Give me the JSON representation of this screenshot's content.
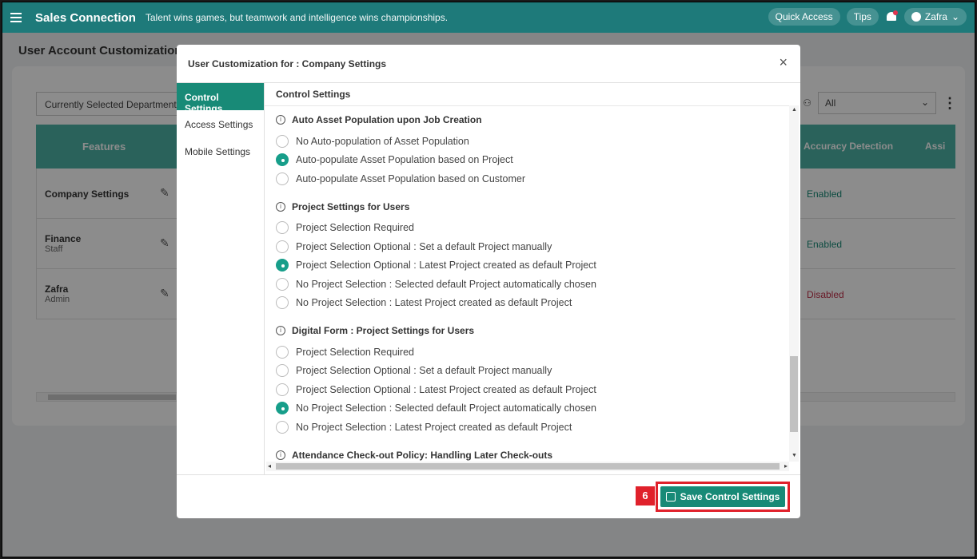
{
  "topbar": {
    "brand": "Sales Connection",
    "tagline": "Talent wins games, but teamwork and intelligence wins championships.",
    "quick_access": "Quick Access",
    "tips": "Tips",
    "user": "Zafra"
  },
  "page": {
    "title": "User Account Customization",
    "dept_select": "Currently Selected Department",
    "right_select": "All",
    "table": {
      "col_features": "Features",
      "col_accuracy": "Accuracy Detection",
      "col_assign": "Assi",
      "rows": [
        {
          "name": "Company Settings",
          "sub": "",
          "status": "Enabled"
        },
        {
          "name": "Finance",
          "sub": "Staff",
          "status": "Enabled"
        },
        {
          "name": "Zafra",
          "sub": "Admin",
          "status": "Disabled"
        }
      ]
    }
  },
  "modal": {
    "title": "User Customization for : Company Settings",
    "close": "×",
    "content_header": "Control Settings",
    "sidebar": [
      "Control Settings",
      "Access Settings",
      "Mobile Settings"
    ],
    "sections": [
      {
        "title": "Auto Asset Population upon Job Creation",
        "options": [
          "No Auto-population of Asset Population",
          "Auto-populate Asset Population based on Project",
          "Auto-populate Asset Population based on Customer"
        ],
        "selected": 1
      },
      {
        "title": "Project Settings for Users",
        "options": [
          "Project Selection Required",
          "Project Selection Optional : Set a default Project manually",
          "Project Selection Optional : Latest Project created as default Project",
          "No Project Selection : Selected default Project automatically chosen",
          "No Project Selection : Latest Project created as default Project"
        ],
        "selected": 2
      },
      {
        "title": "Digital Form : Project Settings for Users",
        "options": [
          "Project Selection Required",
          "Project Selection Optional : Set a default Project manually",
          "Project Selection Optional : Latest Project created as default Project",
          "No Project Selection : Selected default Project automatically chosen",
          "No Project Selection : Latest Project created as default Project"
        ],
        "selected": 3
      },
      {
        "title": "Attendance Check-out Policy: Handling Later Check-outs",
        "options": [],
        "selected": -1
      }
    ],
    "step_badge": "6",
    "save_label": "Save Control Settings"
  },
  "colors": {
    "brand": "#1e7a7a",
    "accent": "#188a77",
    "highlight": "#e0212b"
  }
}
